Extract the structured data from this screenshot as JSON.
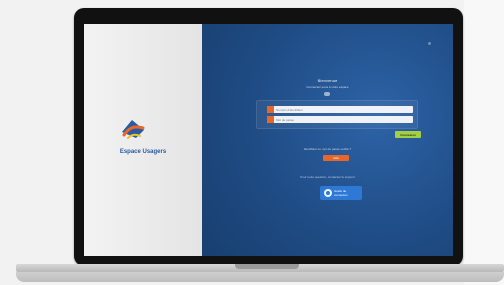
{
  "login_screen": {
    "brand_label": "Espace Usagers",
    "title": "Bienvenue",
    "subtitle": "Connectez-vous à votre espace",
    "username_placeholder": "Numéro d'identifiant",
    "password_placeholder": "Mot de passe",
    "connect_label": "Connexion",
    "forgot_text": "Identifiant ou mot de passe oublié ?",
    "orange_button_label": "Aide",
    "support_text": "Pour toute question, contactez le support",
    "help_button_label": "Guide de connexion"
  },
  "colors": {
    "screen_blue": "#1f4c85",
    "accent_orange": "#e7662a",
    "connect_green": "#a3cf45",
    "help_blue": "#2f79d6"
  },
  "icons": {
    "field_icon": "user-icon",
    "password_icon": "lock-icon",
    "help_icon": "help-icon",
    "logo": "brand-logo-icon"
  }
}
